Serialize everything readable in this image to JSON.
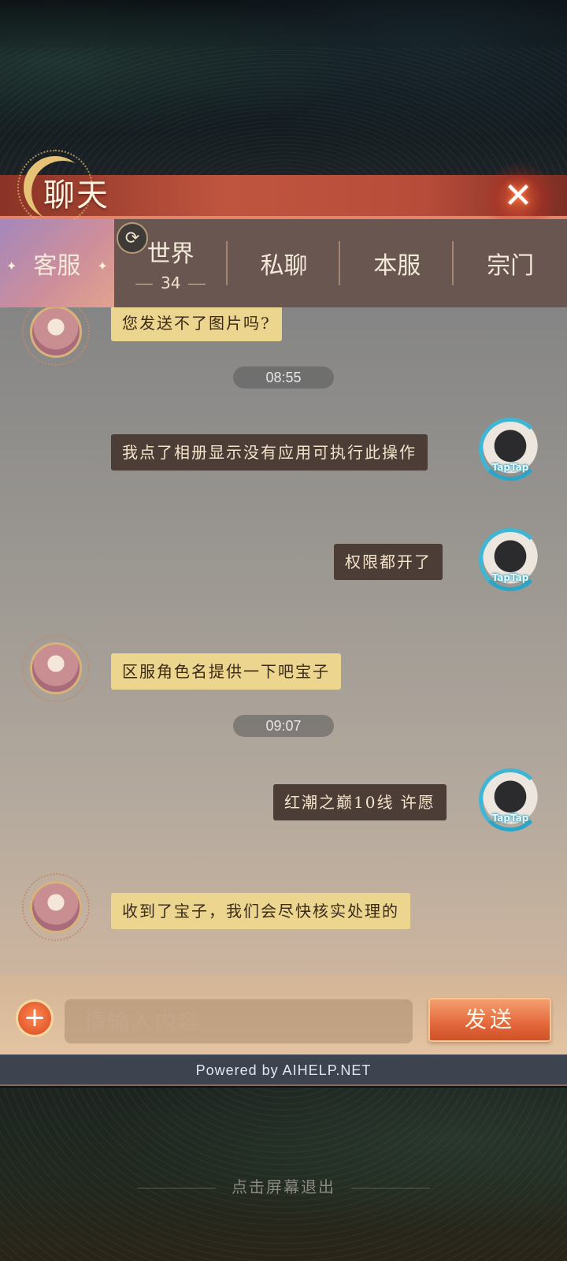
{
  "header": {
    "title": "聊天",
    "close_icon": "close-icon"
  },
  "tabs": [
    {
      "label": "客服",
      "active": true
    },
    {
      "label": "世界",
      "count": "34"
    },
    {
      "label": "私聊"
    },
    {
      "label": "本服"
    },
    {
      "label": "宗门"
    }
  ],
  "messages": [
    {
      "from": "support",
      "text": "您发送不了图片吗?"
    },
    {
      "type": "time",
      "text": "08:55"
    },
    {
      "from": "user",
      "text": "我点了相册显示没有应用可执行此操作"
    },
    {
      "from": "user",
      "text": "权限都开了"
    },
    {
      "from": "support",
      "text": "区服角色名提供一下吧宝子"
    },
    {
      "type": "time",
      "text": "09:07"
    },
    {
      "from": "user",
      "text": "红潮之巅10线 许愿"
    },
    {
      "from": "support",
      "text": "收到了宝子，我们会尽快核实处理的"
    }
  ],
  "user_avatar_tag": "TapTap",
  "input": {
    "placeholder": "请输入内容",
    "value": ""
  },
  "send_label": "发送",
  "add_label": "+",
  "powered_by": "Powered by AIHELP.NET",
  "exit_hint": "点击屏幕退出",
  "colors": {
    "header": "#c0553f",
    "tab_bar": "#6a5650",
    "support_bubble": "#ecd58e",
    "user_bubble": "#4c3d36",
    "send_button": "#e4683c"
  }
}
